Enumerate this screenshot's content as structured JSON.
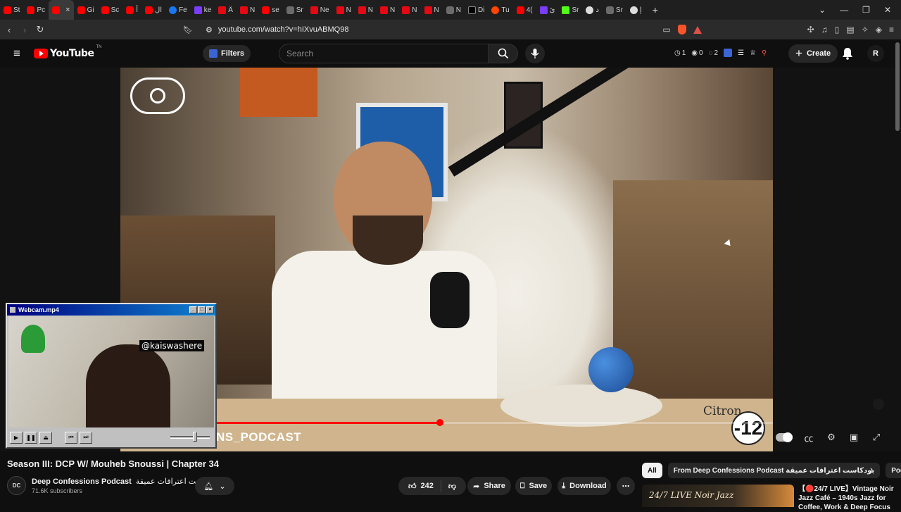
{
  "browser": {
    "tabs": [
      {
        "label": "St",
        "icon": "youtube-icon"
      },
      {
        "label": "Pc",
        "icon": "youtube-icon"
      },
      {
        "label": "",
        "icon": "youtube-icon",
        "active": true
      },
      {
        "label": "Gi",
        "icon": "youtube-icon"
      },
      {
        "label": "Sc",
        "icon": "youtube-icon"
      },
      {
        "label": "أ",
        "icon": "youtube-icon"
      },
      {
        "label": "ال",
        "icon": "youtube-icon"
      },
      {
        "label": "Fe",
        "icon": "facebook-icon"
      },
      {
        "label": "ke",
        "icon": "extension-icon"
      },
      {
        "label": "Ä",
        "icon": "netflix-icon"
      },
      {
        "label": "N",
        "icon": "netflix-icon"
      },
      {
        "label": "se",
        "icon": "youtube-icon"
      },
      {
        "label": "Sr",
        "icon": "shield-icon"
      },
      {
        "label": "Ne",
        "icon": "netflix-icon"
      },
      {
        "label": "N",
        "icon": "netflix-icon"
      },
      {
        "label": "N",
        "icon": "netflix-icon"
      },
      {
        "label": "N",
        "icon": "netflix-icon"
      },
      {
        "label": "N",
        "icon": "netflix-icon"
      },
      {
        "label": "N",
        "icon": "netflix-icon"
      },
      {
        "label": "N",
        "icon": "shield-icon"
      },
      {
        "label": "Di",
        "icon": "x-icon"
      },
      {
        "label": "Tu",
        "icon": "reddit-icon"
      },
      {
        "label": "4(",
        "icon": "youtube-icon"
      },
      {
        "label": "ئ",
        "icon": "extension-icon"
      },
      {
        "label": "Sr",
        "icon": "kick-icon"
      },
      {
        "label": "د",
        "icon": "square-icon"
      },
      {
        "label": "Sr",
        "icon": "shield-icon"
      },
      {
        "label": "إ",
        "icon": "google-icon"
      }
    ],
    "new_tab": "+",
    "url": "youtube.com/watch?v=hIXvuABMQ98"
  },
  "yt_header": {
    "logo_text": "YouTube",
    "logo_tm": "TN",
    "filters_label": "Filters",
    "search_placeholder": "Search",
    "stats": [
      "1",
      "0",
      "2"
    ],
    "create_label": "Create",
    "avatar_letter": "R"
  },
  "player": {
    "overlay_text": "NS_PODCAST",
    "badge_text": "-12",
    "product_label": "Citron",
    "progress_fraction": 0.49
  },
  "webcam": {
    "title": "Webcam.mp4",
    "handle": "@kaiswashere"
  },
  "video": {
    "title": "Season III: DCP W/ Mouheb Snoussi | Chapter 34",
    "channel_name": "Deep Confessions Podcast",
    "channel_name_ar": "بودكاست اعترافات عميقة",
    "channel_avatar_text": "DC",
    "subscribers": "71.6K subscribers",
    "likes": "242",
    "share_label": "Share",
    "save_label": "Save",
    "download_label": "Download"
  },
  "sidebar": {
    "chips": [
      "All",
      "From Deep Confessions Podcast بودكاست اعترافات عميقة",
      "Podcasts"
    ],
    "rec_thumb_text": "24/7 LIVE Noir Jazz",
    "rec_title": "【🔴24/7 LIVE】Vintage Noir Jazz Café – 1940s Jazz for Coffee, Work & Deep Focus"
  },
  "colors": {
    "yt_red": "#ff0000",
    "background": "#0f0f0f",
    "pill": "#272727"
  }
}
